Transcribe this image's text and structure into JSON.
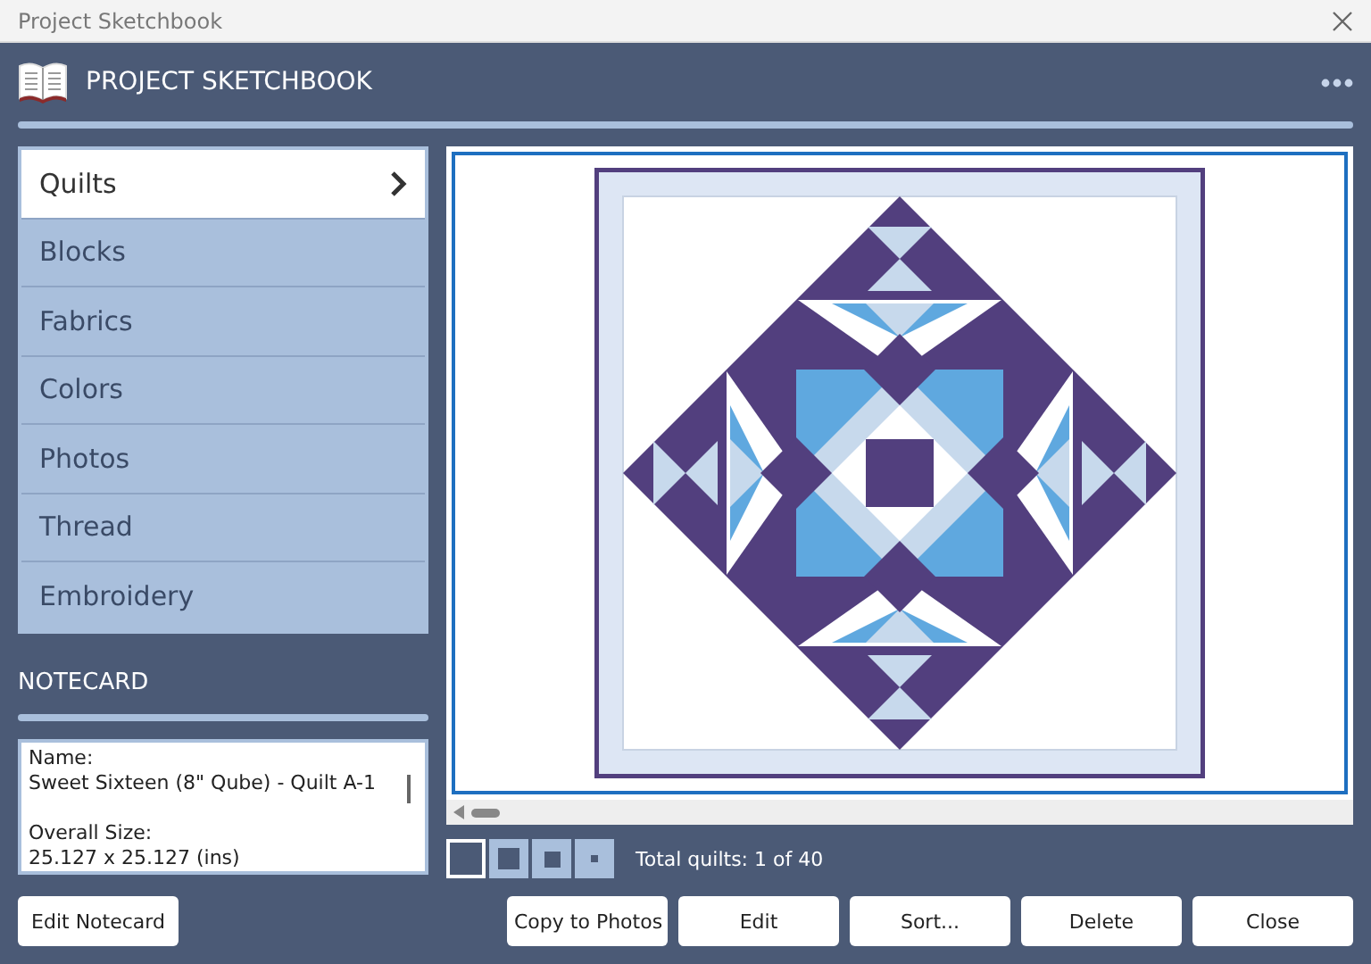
{
  "window": {
    "title": "Project Sketchbook"
  },
  "header": {
    "title": "PROJECT SKETCHBOOK"
  },
  "nav": [
    {
      "label": "Quilts",
      "selected": true
    },
    {
      "label": "Blocks",
      "selected": false
    },
    {
      "label": "Fabrics",
      "selected": false
    },
    {
      "label": "Colors",
      "selected": false
    },
    {
      "label": "Photos",
      "selected": false
    },
    {
      "label": "Thread",
      "selected": false
    },
    {
      "label": "Embroidery",
      "selected": false
    }
  ],
  "notecard": {
    "heading": "NOTECARD",
    "fields": [
      {
        "label": "Name:",
        "value": "Sweet Sixteen (8\" Qube) - Quilt A-1"
      },
      {
        "label": "Overall Size:",
        "value": "25.127 x 25.127 (ins)"
      }
    ],
    "button": "Edit Notecard"
  },
  "thumb_sizes": [
    {
      "selected": true
    },
    {
      "selected": false
    },
    {
      "selected": false
    },
    {
      "selected": false
    }
  ],
  "total": "Total quilts: 1 of 40",
  "buttons": [
    "Copy to Photos",
    "Edit",
    "Sort...",
    "Delete",
    "Close"
  ]
}
